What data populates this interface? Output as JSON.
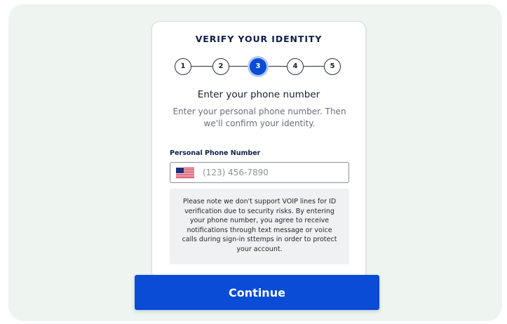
{
  "header": {
    "title": "VERIFY YOUR IDENTITY"
  },
  "stepper": {
    "steps": [
      "1",
      "2",
      "3",
      "4",
      "5"
    ],
    "current_step": 3
  },
  "content": {
    "heading": "Enter your phone number",
    "subtext": "Enter your personal phone number. Then we'll confirm your identity."
  },
  "phone": {
    "label": "Personal Phone Number",
    "placeholder": "(123) 456-7890",
    "value": "",
    "country_flag": "us-flag-icon"
  },
  "notice": {
    "text": "Please note we don't support VOIP lines for ID verification due to security risks. By entering your phone number, you agree to receive notifications through text message or voice calls during sign-in sttemps in order to protect your account."
  },
  "actions": {
    "continue_label": "Continue"
  },
  "colors": {
    "primary": "#0a4cd6",
    "navy_text": "#0f1f4a",
    "background": "#eef5f0",
    "notice_bg": "#f0f1f3"
  }
}
